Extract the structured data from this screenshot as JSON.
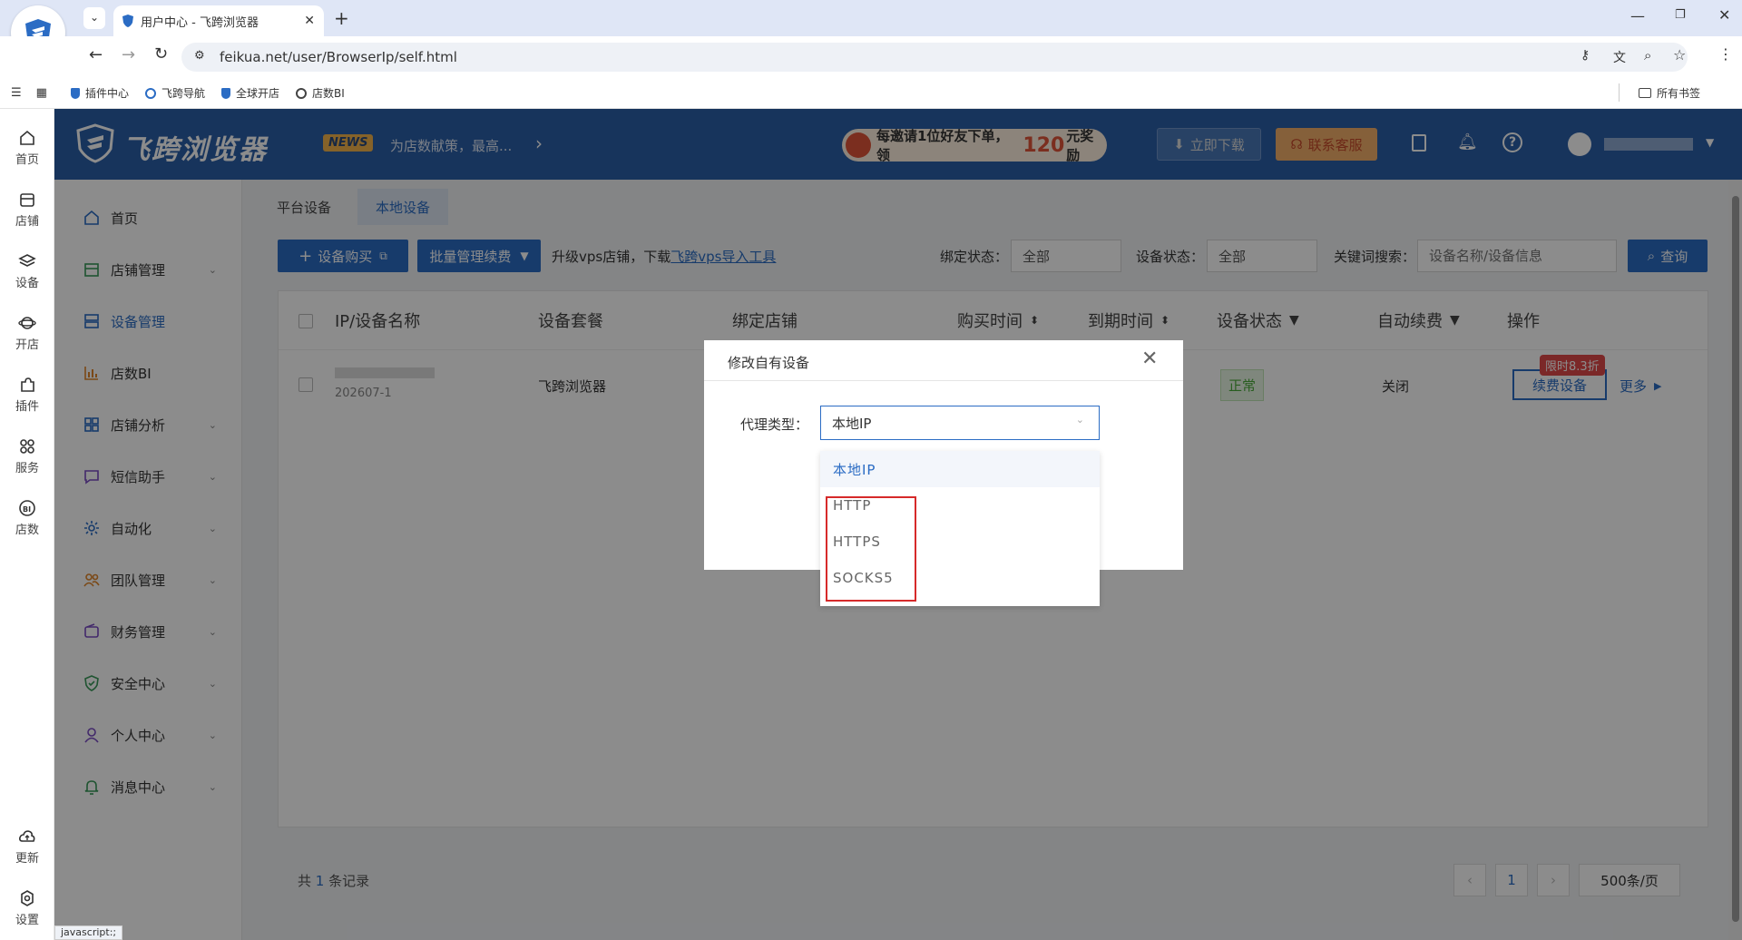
{
  "browser": {
    "tab_title": "用户中心 - 飞跨浏览器",
    "url": "feikua.net/user/BrowserIp/self.html",
    "bookmarks": [
      "插件中心",
      "飞跨导航",
      "全球开店",
      "店数BI"
    ],
    "all_bookmarks": "所有书签",
    "status_url": "javascript:;"
  },
  "rail": {
    "items": [
      "首页",
      "店铺",
      "设备",
      "开店",
      "插件",
      "服务",
      "店数",
      "更新",
      "设置"
    ]
  },
  "header": {
    "logo": "飞跨浏览器",
    "news_badge": "NEWS",
    "news_text": "为店数献策，最高...",
    "promo_prefix": "每邀请1位好友下单，领",
    "promo_amount": "120",
    "promo_suffix": "元奖励",
    "download_btn": "立即下载",
    "support_btn": "联系客服"
  },
  "sidebar": {
    "items": [
      {
        "label": "首页",
        "arrow": ""
      },
      {
        "label": "店铺管理",
        "arrow": "⌄"
      },
      {
        "label": "设备管理",
        "arrow": ""
      },
      {
        "label": "店数BI",
        "arrow": ""
      },
      {
        "label": "店铺分析",
        "arrow": "⌄"
      },
      {
        "label": "短信助手",
        "arrow": "⌄"
      },
      {
        "label": "自动化",
        "arrow": "⌄"
      },
      {
        "label": "团队管理",
        "arrow": "⌄"
      },
      {
        "label": "财务管理",
        "arrow": "⌄"
      },
      {
        "label": "安全中心",
        "arrow": "⌄"
      },
      {
        "label": "个人中心",
        "arrow": "⌄"
      },
      {
        "label": "消息中心",
        "arrow": "⌄"
      }
    ]
  },
  "content": {
    "tabs": [
      "平台设备",
      "本地设备"
    ],
    "buy_btn": "设备购买",
    "batch_btn": "批量管理续费",
    "upgrade_text": "升级vps店铺，下载",
    "upgrade_link": "飞跨vps导入工具",
    "bind_label": "绑定状态：",
    "bind_value": "全部",
    "status_label": "设备状态：",
    "status_value": "全部",
    "keyword_label": "关键词搜索：",
    "keyword_placeholder": "设备名称/设备信息",
    "query_btn": "查询"
  },
  "table": {
    "headers": [
      "IP/设备名称",
      "设备套餐",
      "绑定店铺",
      "购买时间",
      "到期时间",
      "设备状态",
      "自动续费",
      "操作"
    ],
    "row": {
      "device_sub": "202607-1",
      "package": "飞跨浏览器",
      "status": "正常",
      "auto_renew": "关闭",
      "discount": "限时8.3折",
      "renew_btn": "续费设备",
      "more": "更多"
    }
  },
  "pagination": {
    "total_prefix": "共",
    "total": "1",
    "total_suffix": "条记录",
    "page": "1",
    "page_size": "500条/页"
  },
  "dialog": {
    "title": "修改自有设备",
    "proxy_label": "代理类型：",
    "proxy_value": "本地IP",
    "options": [
      "本地IP",
      "HTTP",
      "HTTPS",
      "SOCKS5"
    ]
  }
}
